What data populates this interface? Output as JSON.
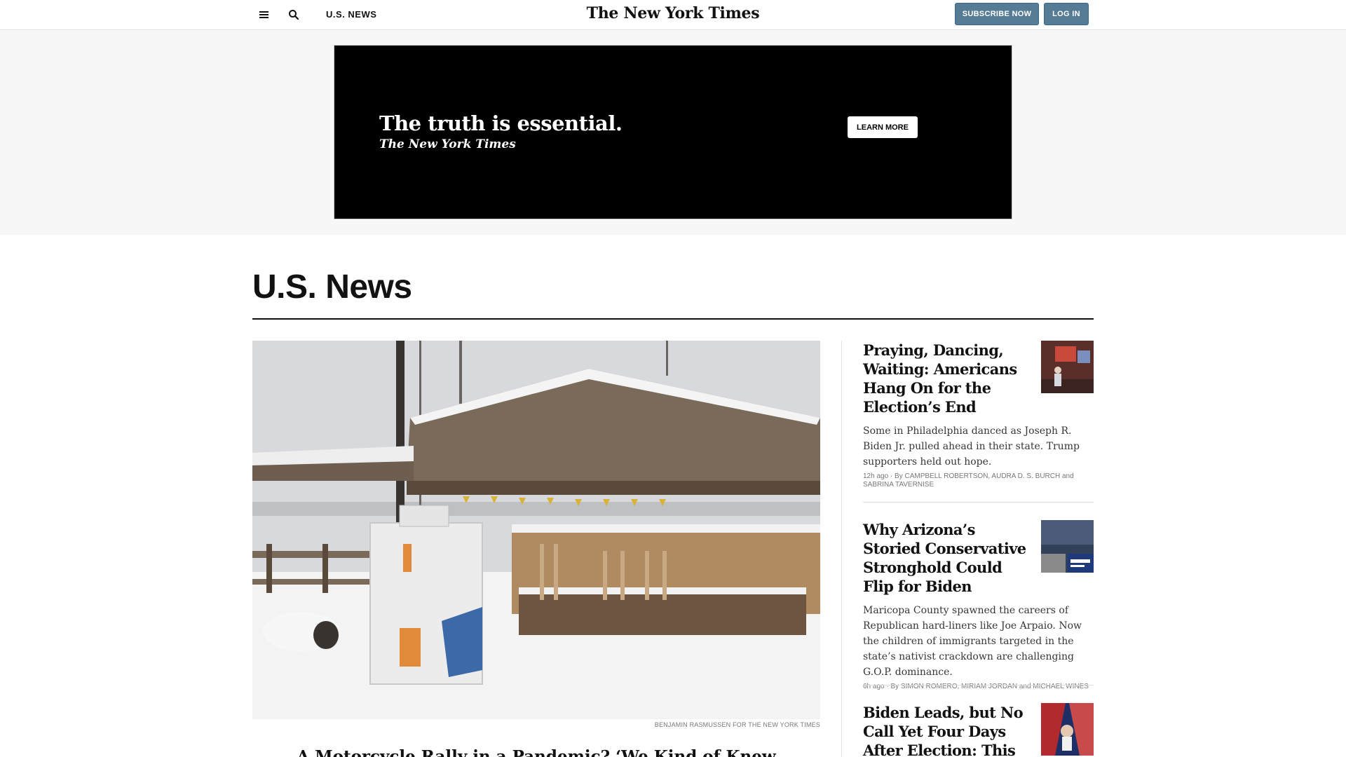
{
  "topbar": {
    "section": "U.S. NEWS",
    "logo": "The New York Times",
    "subscribe": "SUBSCRIBE NOW",
    "login": "LOG IN"
  },
  "ad": {
    "headline": "The truth is essential.",
    "logo": "The New York Times",
    "cta": "LEARN MORE"
  },
  "page": {
    "title": "U.S. News"
  },
  "lead": {
    "credit": "BENJAMIN RASMUSSEN FOR THE NEW YORK TIMES",
    "headline": "A Motorcycle Rally in a Pandemic? ‘We Kind of Knew"
  },
  "stories": [
    {
      "title": "Praying, Dancing, Waiting: Americans Hang On for the Election’s End",
      "summary": "Some in Philadelphia danced as Joseph R. Biden Jr. pulled ahead in their state. Trump supporters held out hope.",
      "time": "12h ago",
      "byline": "By CAMPBELL ROBERTSON, AUDRA D. S. BURCH and SABRINA TAVERNISE"
    },
    {
      "title": "Why Arizona’s Storied Conservative Stronghold Could Flip for Biden",
      "summary": "Maricopa County spawned the careers of Republican hard-liners like Joe Arpaio. Now the children of immigrants targeted in the state’s nativist crackdown are challenging G.O.P. dominance.",
      "time": "6h ago",
      "byline": "By SIMON ROMERO, MIRIAM JORDAN and MICHAEL WINES"
    },
    {
      "title": "Biden Leads, but No Call Yet Four Days After Election: This Week in",
      "summary": "",
      "time": "",
      "byline": ""
    }
  ],
  "colors": {
    "subscribe_bg": "#567b95",
    "ad_bg": "#000000",
    "band_bg": "#f7f7f7"
  }
}
